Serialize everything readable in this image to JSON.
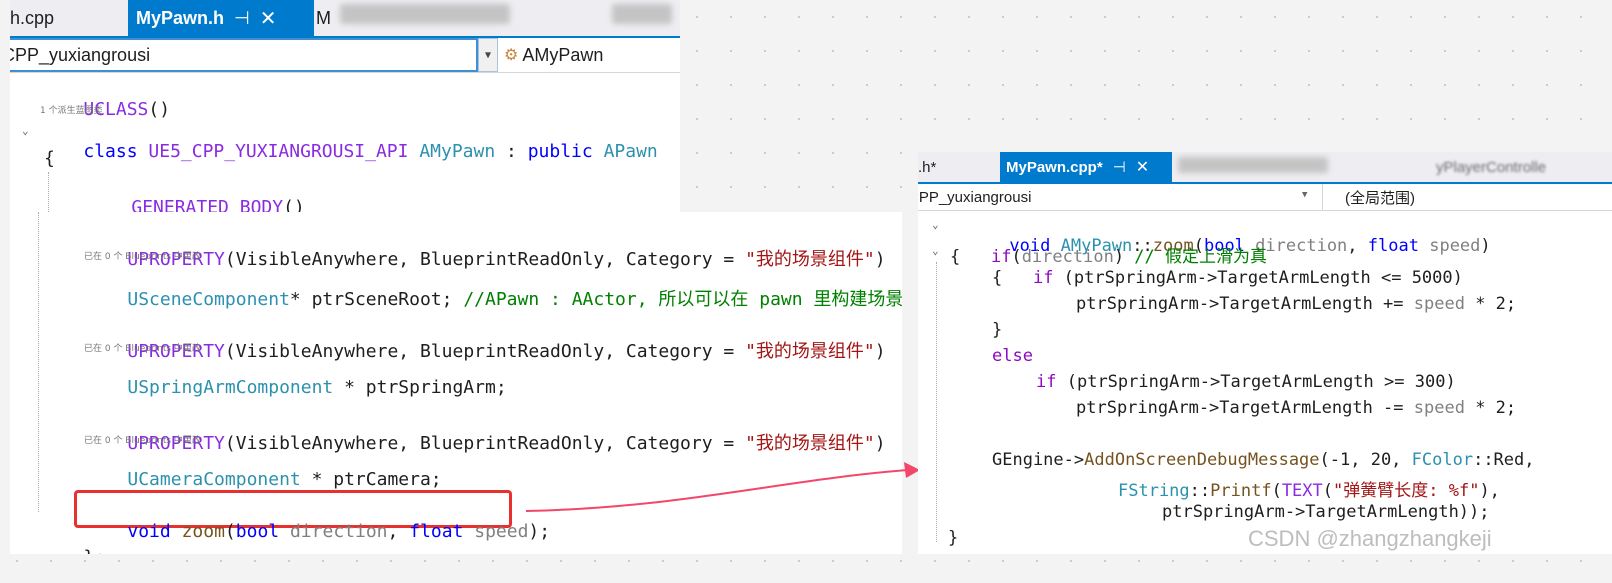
{
  "left_editor": {
    "tabs": {
      "prev_tab": "h.cpp",
      "active_tab": "MyPawn.h",
      "blurred_tab_prefix": "M"
    },
    "nav": {
      "project": "CPP_yuxiangrousi",
      "class_name": "AMyPawn"
    },
    "code": {
      "uclass": "UCLASS",
      "uclass_hint": "1 个派生蓝图类",
      "kw_class": "class",
      "api_macro": "UE5_CPP_YUXIANGROUSI_API",
      "type_amypawn": "AMyPawn",
      "kw_public": "public",
      "type_apawn": "APawn",
      "generated_body": "GENERATED_BODY",
      "uproperty": "UPROPERTY",
      "uproperty_args": "(VisibleAnywhere, BlueprintReadOnly, Category = ",
      "category_str": "\"我的场景组件\"",
      "change_hint": "已在 0 个 Blueprints 中更改",
      "type_scene": "USceneComponent",
      "scene_decl": "* ptrSceneRoot;",
      "scene_comment": "//APawn : AActor, 所以可以在 pawn 里构建场景",
      "type_spring": "USpringArmComponent",
      "spring_decl": " * ptrSpringArm;",
      "type_camera": "UCameraComponent",
      "camera_decl": " * ptrCamera;",
      "kw_void": "void",
      "fn_zoom": "zoom",
      "kw_bool": "bool",
      "param_direction": "direction",
      "kw_float": "float",
      "param_speed": "speed",
      "end_class": "};"
    }
  },
  "right_editor": {
    "tabs": {
      "prev_tab": ".h*",
      "active_tab": "MyPawn.cpp*",
      "blurred_tab_suffix": "yPlayerControlle"
    },
    "nav": {
      "project": "CPP_yuxiangrousi",
      "scope": "(全局范围)"
    },
    "code": {
      "kw_void": "void",
      "type_amypawn": "AMyPawn",
      "fn_zoom": "zoom",
      "kw_bool": "bool",
      "param_direction": "direction",
      "kw_float": "float",
      "param_speed": "speed",
      "kw_if": "if",
      "comment_up": "// 假定上滑为真",
      "member_spring": "ptrSpringArm->TargetArmLength",
      "max_len": "5000",
      "min_len": "300",
      "kw_else": "else",
      "gengine": "GEngine->",
      "fn_add": "AddOnScreenDebugMessage",
      "args_prefix": "(-1, 20, ",
      "type_fcolor": "FColor",
      "red_suffix": "::Red,",
      "type_fstring": "FString",
      "fn_printf": "Printf",
      "fn_text": "TEXT",
      "fmt_str": "\"弹簧臂长度: %f\"",
      "final_arg": "ptrSpringArm->TargetArmLength));"
    }
  },
  "watermark": "CSDN @zhangzhangkeji",
  "colors": {
    "highlight_box": "#e8312f",
    "arrow": "#f2476b",
    "accent": "#007acc"
  }
}
